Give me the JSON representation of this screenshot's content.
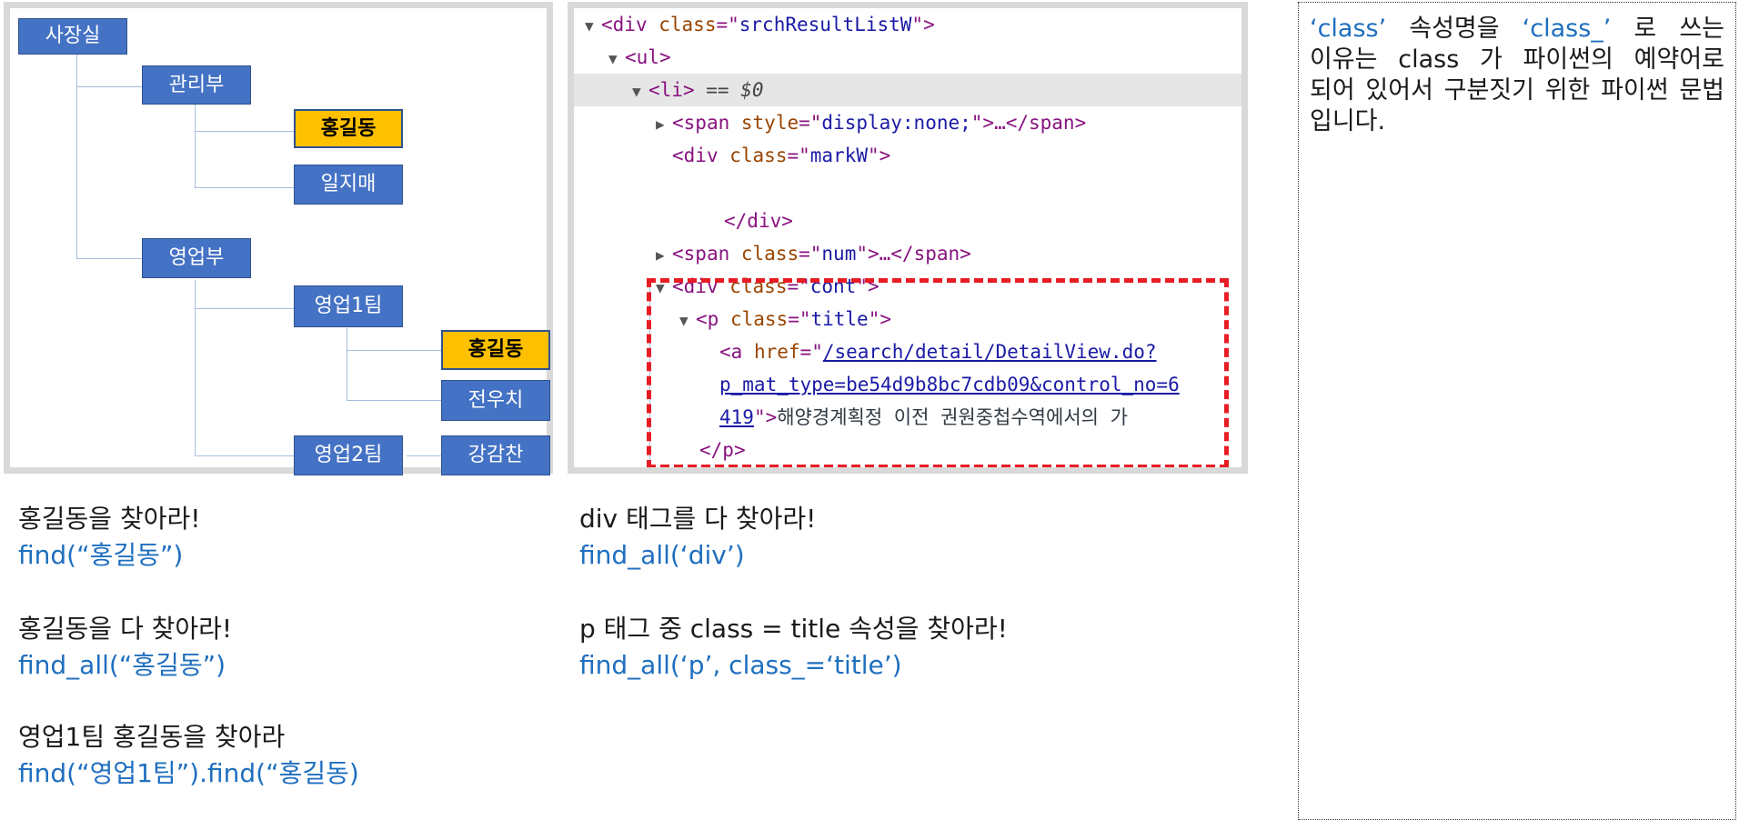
{
  "org_chart": {
    "ceo": "사장실",
    "admin_dept": "관리부",
    "admin_member_1": "홍길동",
    "admin_member_2": "일지매",
    "sales_dept": "영업부",
    "sales_team_1": "영업1팀",
    "team1_member_1": "홍길동",
    "team1_member_2": "전우치",
    "sales_team_2": "영업2팀",
    "team2_member_1": "강감찬",
    "colors": {
      "node": "#4472c4",
      "highlight": "#ffc000",
      "line": "#a6bedc"
    }
  },
  "devtools": {
    "l1": {
      "open": "<",
      "tag": "div",
      "attr": "class",
      "eq": "=\"",
      "val": "srchResultListW",
      "close": "\">"
    },
    "l2": {
      "open": "<",
      "tag": "ul",
      "close": ">"
    },
    "l3": {
      "open": "<",
      "tag": "li",
      "close": ">",
      "marker": "== $0"
    },
    "l4": {
      "open": "<",
      "tag": "span",
      "attr": "style",
      "eq": "=\"",
      "val": "display:none;",
      "mid": "\">…</",
      "tag2": "span",
      "close": ">"
    },
    "l5": {
      "open": "<",
      "tag": "div",
      "attr": "class",
      "eq": "=\"",
      "val": "markW",
      "close": "\">"
    },
    "l6": {
      "open": "</",
      "tag": "div",
      "close": ">"
    },
    "l7": {
      "open": "<",
      "tag": "span",
      "attr": "class",
      "eq": "=\"",
      "val": "num",
      "mid": "\">…</",
      "tag2": "span",
      "close": ">"
    },
    "l8": {
      "open": "<",
      "tag": "div",
      "attr": "class",
      "eq": "=\"",
      "val": "cont",
      "close": "\">"
    },
    "l9": {
      "open": "<",
      "tag": "p",
      "attr": "class",
      "eq": "=\"",
      "val": "title",
      "close": "\">"
    },
    "l10": {
      "open": "<",
      "tag": "a",
      "attr": "href",
      "eq": "=\"",
      "link": "/search/detail/DetailView.do?"
    },
    "l11": {
      "link": "p_mat_type=be54d9b8bc7cdb09&control_no=6"
    },
    "l12": {
      "link": "419",
      "quote": "\">",
      "text": "해양경계획정 이전 권원중첩수역에서의 가"
    },
    "l13": {
      "open": "</",
      "tag": "p",
      "close": ">"
    },
    "highlight_color": "#e81c24"
  },
  "captions": {
    "left": [
      {
        "text": "홍길동을 찾아라!",
        "code": "find(“홍길동”)"
      },
      {
        "text": "홍길동을 다 찾아라!",
        "code": "find_all(“홍길동”)"
      },
      {
        "text": "영업1팀 홍길동을 찾아라",
        "code": "find(“영업1팀”).find(“홍길동)"
      }
    ],
    "right": [
      {
        "text": "div 태그를 다 찾아라!",
        "code": "find_all(‘div’)"
      },
      {
        "text": "p 태그 중 class = title 속성을 찾아라!",
        "code": "find_all(‘p’, class_=‘title’)"
      }
    ]
  },
  "note": {
    "kw1": "‘class’",
    "part1": " 속성명을 ",
    "kw2": "‘class_’",
    "part2": " 로 쓰는 이유는 class 가 파이썬의 예약어로 되어 있어서 구분짓기 위한 파이썬 문법 입니다."
  }
}
